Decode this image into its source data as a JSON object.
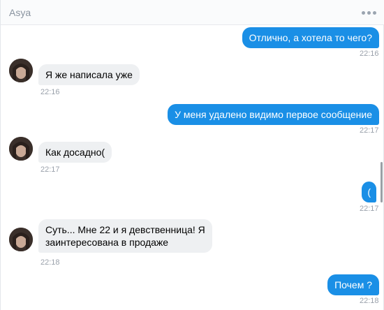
{
  "header": {
    "title": "Asya",
    "more_icon": "more-horizontal-icon"
  },
  "messages": [
    {
      "direction": "out",
      "text": "Отлично, а хотела то чего?",
      "time": "22:16"
    },
    {
      "direction": "in",
      "text": "Я же написала уже",
      "time": "22:16",
      "avatar": "avatar-icon"
    },
    {
      "direction": "out",
      "text": "У меня удалено видимо первое сообщение",
      "time": "22:17"
    },
    {
      "direction": "in",
      "text": "Как досадно(",
      "time": "22:17",
      "avatar": "avatar-icon"
    },
    {
      "direction": "out",
      "text": "(",
      "time": "22:17"
    },
    {
      "direction": "in",
      "text_line1": "Суть... Мне 22 и я девственница! Я",
      "text_line2": "заинтересована в продаже",
      "time": "22:18",
      "avatar": "avatar-icon"
    },
    {
      "direction": "out",
      "text": "Почем ?",
      "time": "22:18"
    }
  ],
  "colors": {
    "outgoing_bubble": "#1a8fe6",
    "incoming_bubble": "#eef0f2",
    "timestamp": "#9aa1ab"
  }
}
